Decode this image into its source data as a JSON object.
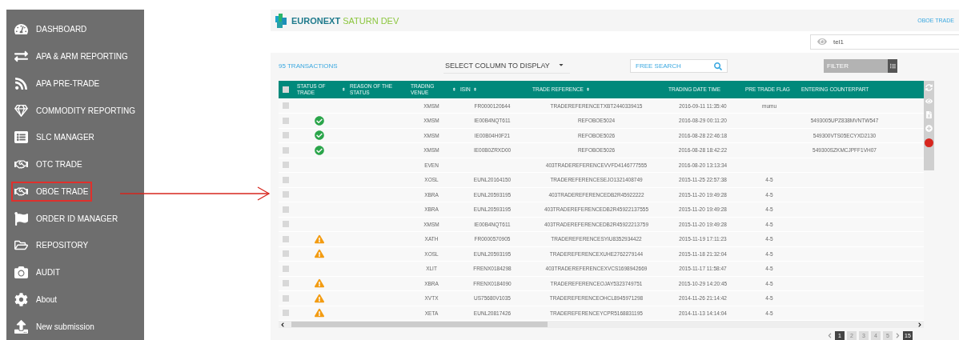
{
  "sidebar": {
    "items": [
      {
        "label": "DASHBOARD",
        "selected": false
      },
      {
        "label": "APA & ARM REPORTING",
        "selected": false
      },
      {
        "label": "APA PRE-TRADE",
        "selected": false
      },
      {
        "label": "COMMODITY REPORTING",
        "selected": false
      },
      {
        "label": "SLC MANAGER",
        "selected": false
      },
      {
        "label": "OTC TRADE",
        "selected": false
      },
      {
        "label": "OBOE TRADE",
        "selected": true
      },
      {
        "label": "ORDER ID MANAGER",
        "selected": false
      },
      {
        "label": "REPOSITORY",
        "selected": false
      },
      {
        "label": "AUDIT",
        "selected": false
      },
      {
        "label": "About",
        "selected": false
      },
      {
        "label": "New submission",
        "selected": false
      }
    ]
  },
  "header": {
    "brand": "EURONEXT",
    "brand_suffix": "SATURN DEV",
    "breadcrumb": "OBOE TRADE"
  },
  "user_field": {
    "value": "tel1"
  },
  "toolbar": {
    "count": "95 TRANSACTIONS",
    "column_select": "SELECT COLUMN TO DISPLAY",
    "search": {
      "placeholder": "FREE SEARCH"
    },
    "filter": {
      "placeholder": "FILTER"
    }
  },
  "table": {
    "header_checkbox": {
      "checked": false
    },
    "columns": [
      "STATUS OF TRADE",
      "REASON OF THE STATUS",
      "TRADING VENUE",
      "ISIN",
      "TRADE REFERENCE",
      "TRADING DATE TIME",
      "PRE TRADE FLAG",
      "ENTERING COUNTERPART"
    ],
    "sortable": [
      true,
      false,
      true,
      true,
      true,
      false,
      false,
      false
    ],
    "rows": [
      {
        "checked": false,
        "kind": "none",
        "venue": "XMSM",
        "isin": "FR0000120644",
        "reference": "TRADEREFERENCETXBT2440339415",
        "datetime": "2016-09-11 11:35:40",
        "flag": "mumu",
        "counterpart": ""
      },
      {
        "checked": false,
        "kind": "ok",
        "venue": "XMSM",
        "isin": "IE00B4NQT611",
        "reference": "REFOBOE5024",
        "datetime": "2016-08-29 00:11:20",
        "flag": "",
        "counterpart": "5493005UPZ838MVNTW547"
      },
      {
        "checked": false,
        "kind": "ok",
        "venue": "XMSM",
        "isin": "IE00B04H0F21",
        "reference": "REFOBOE5026",
        "datetime": "2016-08-28 22:46:18",
        "flag": "",
        "counterpart": "549300VTS05ECYXD2130"
      },
      {
        "checked": false,
        "kind": "ok",
        "venue": "XMSM",
        "isin": "IE00B0ZRXD00",
        "reference": "REFOBOE5026",
        "datetime": "2016-08-28 18:42:22",
        "flag": "",
        "counterpart": "549300SZKMCJPFF1VH07"
      },
      {
        "checked": false,
        "kind": "none",
        "venue": "EVEN",
        "isin": "",
        "reference": "403TRADEREFERENCEVVFD4146777555",
        "datetime": "2016-08-20 13:13:34",
        "flag": "",
        "counterpart": ""
      },
      {
        "checked": false,
        "kind": "none",
        "venue": "XOSL",
        "isin": "EUNL20164150",
        "reference": "TRADEREFERENCESEJO1321408749",
        "datetime": "2015-11-25 22:57:38",
        "flag": "4-5",
        "counterpart": ""
      },
      {
        "checked": false,
        "kind": "none",
        "venue": "XBRA",
        "isin": "EUNL20593195",
        "reference": "403TRADEREFERENCEDB2R45922222",
        "datetime": "2015-11-20 19:49:28",
        "flag": "4-5",
        "counterpart": ""
      },
      {
        "checked": false,
        "kind": "none",
        "venue": "XBRA",
        "isin": "EUNL20593195",
        "reference": "403TRADEREFERENCEDB2R45922137555",
        "datetime": "2015-11-20 19:49:28",
        "flag": "4-5",
        "counterpart": ""
      },
      {
        "checked": false,
        "kind": "none",
        "venue": "XMSM",
        "isin": "IE00B4NQT611",
        "reference": "403TRADEREFERENCEDB2R45922213759",
        "datetime": "2015-11-20 19:49:28",
        "flag": "4-5",
        "counterpart": ""
      },
      {
        "checked": false,
        "kind": "warning",
        "venue": "XATH",
        "isin": "FR0000570905",
        "reference": "TRADEREFERENCESYIU8352934422",
        "datetime": "2015-11-19 17:11:23",
        "flag": "4-5",
        "counterpart": ""
      },
      {
        "checked": false,
        "kind": "warning",
        "venue": "XOSL",
        "isin": "EUNL20593195",
        "reference": "TRADEREFERENCEXUHE2762279144",
        "datetime": "2015-11-18 21:32:04",
        "flag": "4-5",
        "counterpart": ""
      },
      {
        "checked": false,
        "kind": "none",
        "venue": "XLIT",
        "isin": "FRENX0184298",
        "reference": "403TRADEREFERENCEXVCS1698942669",
        "datetime": "2015-11-17 11:58:47",
        "flag": "4-5",
        "counterpart": ""
      },
      {
        "checked": false,
        "kind": "warning",
        "venue": "XBRA",
        "isin": "FRENX0184090",
        "reference": "TRADEREFERENCEOJAY5323749751",
        "datetime": "2015-10-29 14:20:45",
        "flag": "4-5",
        "counterpart": ""
      },
      {
        "checked": false,
        "kind": "warning",
        "venue": "XVTX",
        "isin": "US75680V1035",
        "reference": "TRADEREFERENCEOHCL8945971298",
        "datetime": "2014-11-26 21:14:42",
        "flag": "4-5",
        "counterpart": ""
      },
      {
        "checked": false,
        "kind": "warning",
        "venue": "XETA",
        "isin": "EUNL20817426",
        "reference": "TRADEREFERENCEYCPR5168831195",
        "datetime": "2014-11-13 14:14:04",
        "flag": "4-5",
        "counterpart": ""
      }
    ]
  },
  "pagination": {
    "pages": [
      {
        "label": "1",
        "selected": true
      },
      {
        "label": "2",
        "selected": false
      },
      {
        "label": "3",
        "selected": false
      },
      {
        "label": "4",
        "selected": false
      },
      {
        "label": "5",
        "selected": false
      }
    ],
    "page_size": "15"
  }
}
